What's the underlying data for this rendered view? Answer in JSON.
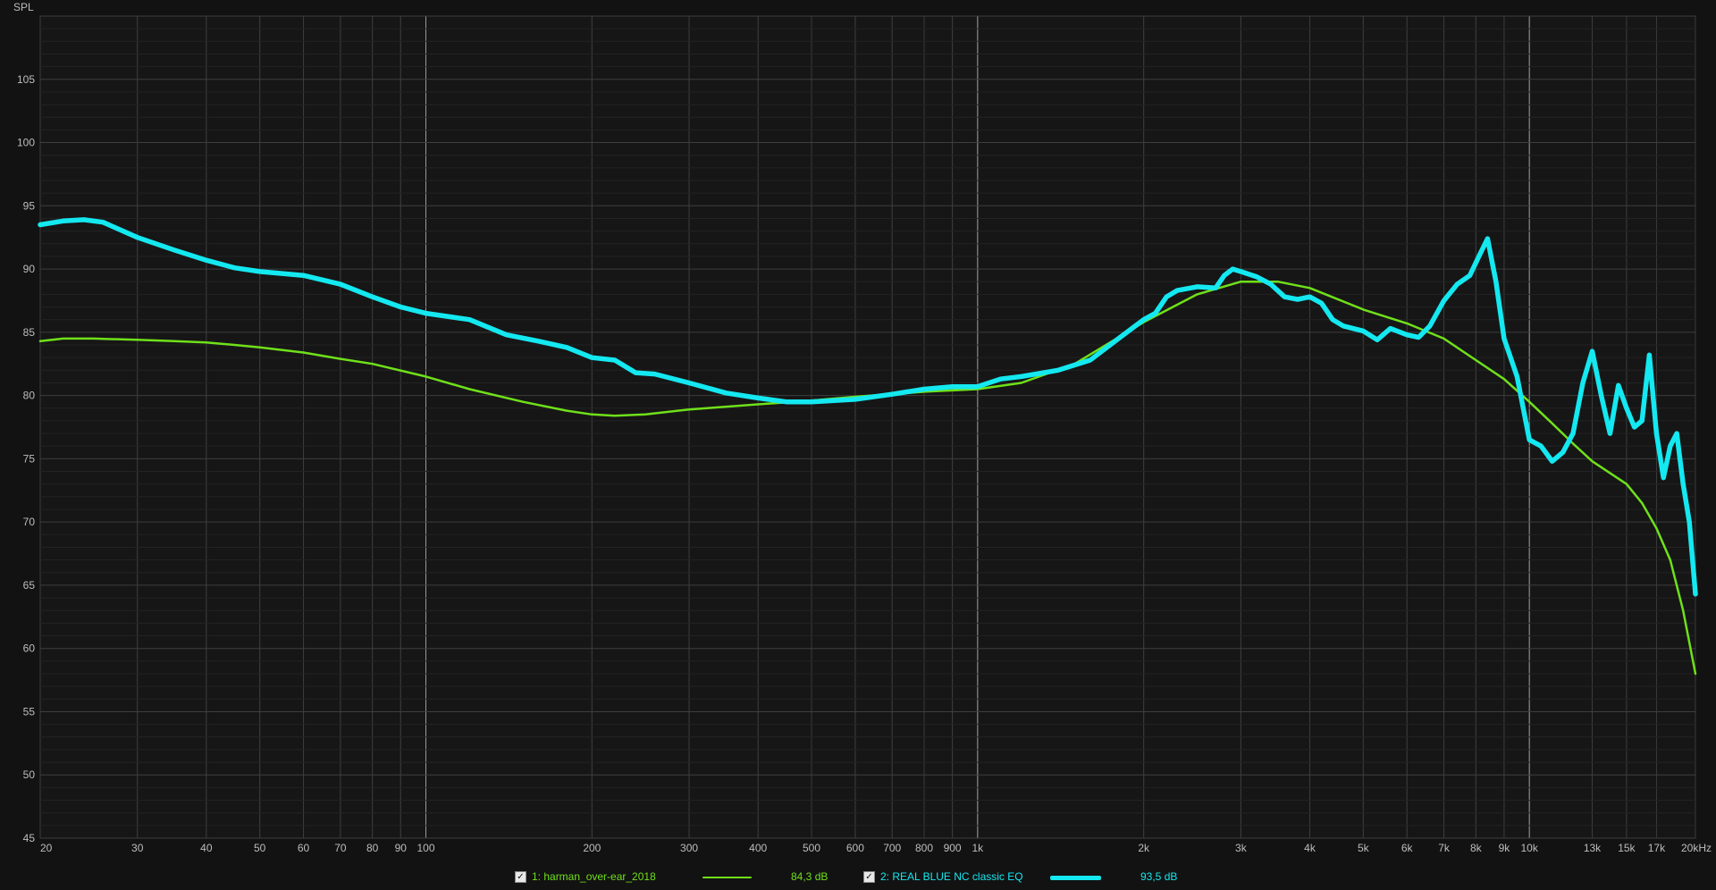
{
  "chart_data": {
    "type": "line",
    "ylabel": "SPL",
    "xscale": "log",
    "xlim": [
      20,
      20000
    ],
    "ylim": [
      45,
      110
    ],
    "yticks": [
      45,
      50,
      55,
      60,
      65,
      70,
      75,
      80,
      85,
      90,
      95,
      100,
      105
    ],
    "xticks": [
      {
        "v": 20,
        "l": "20"
      },
      {
        "v": 30,
        "l": "30"
      },
      {
        "v": 40,
        "l": "40"
      },
      {
        "v": 50,
        "l": "50"
      },
      {
        "v": 60,
        "l": "60"
      },
      {
        "v": 70,
        "l": "70"
      },
      {
        "v": 80,
        "l": "80"
      },
      {
        "v": 90,
        "l": "90"
      },
      {
        "v": 100,
        "l": "100"
      },
      {
        "v": 200,
        "l": "200"
      },
      {
        "v": 300,
        "l": "300"
      },
      {
        "v": 400,
        "l": "400"
      },
      {
        "v": 500,
        "l": "500"
      },
      {
        "v": 600,
        "l": "600"
      },
      {
        "v": 700,
        "l": "700"
      },
      {
        "v": 800,
        "l": "800"
      },
      {
        "v": 900,
        "l": "900"
      },
      {
        "v": 1000,
        "l": "1k"
      },
      {
        "v": 2000,
        "l": "2k"
      },
      {
        "v": 3000,
        "l": "3k"
      },
      {
        "v": 4000,
        "l": "4k"
      },
      {
        "v": 5000,
        "l": "5k"
      },
      {
        "v": 6000,
        "l": "6k"
      },
      {
        "v": 7000,
        "l": "7k"
      },
      {
        "v": 8000,
        "l": "8k"
      },
      {
        "v": 9000,
        "l": "9k"
      },
      {
        "v": 10000,
        "l": "10k"
      },
      {
        "v": 13000,
        "l": "13k"
      },
      {
        "v": 15000,
        "l": "15k"
      },
      {
        "v": 17000,
        "l": "17k"
      },
      {
        "v": 20000,
        "l": "20kHz"
      }
    ],
    "major_x_lines": [
      100,
      1000,
      10000
    ],
    "grid": true,
    "series": [
      {
        "name": "1: harman_over-ear_2018",
        "color": "#6fe01a",
        "x": [
          20,
          22,
          25,
          30,
          35,
          40,
          45,
          50,
          60,
          70,
          80,
          100,
          120,
          150,
          180,
          200,
          220,
          250,
          300,
          400,
          500,
          600,
          800,
          1000,
          1200,
          1500,
          2000,
          2500,
          3000,
          3500,
          4000,
          5000,
          6000,
          7000,
          8000,
          9000,
          10000,
          11000,
          12000,
          13000,
          15000,
          16000,
          17000,
          18000,
          19000,
          20000
        ],
        "values": [
          84.3,
          84.5,
          84.5,
          84.4,
          84.3,
          84.2,
          84.0,
          83.8,
          83.4,
          82.9,
          82.5,
          81.5,
          80.5,
          79.5,
          78.8,
          78.5,
          78.4,
          78.5,
          78.9,
          79.3,
          79.6,
          79.9,
          80.3,
          80.5,
          81.0,
          82.5,
          85.8,
          88.0,
          89.0,
          89.0,
          88.5,
          86.8,
          85.7,
          84.5,
          82.8,
          81.3,
          79.5,
          77.8,
          76.2,
          74.8,
          73.0,
          71.5,
          69.5,
          67.0,
          63.0,
          58.0
        ]
      },
      {
        "name": "2: REAL BLUE NC classic EQ",
        "color": "#14e8f0",
        "x": [
          20,
          22,
          24,
          26,
          30,
          35,
          40,
          45,
          50,
          60,
          70,
          80,
          90,
          100,
          120,
          140,
          160,
          180,
          200,
          220,
          240,
          260,
          300,
          350,
          400,
          450,
          500,
          600,
          700,
          800,
          900,
          1000,
          1100,
          1200,
          1400,
          1600,
          1800,
          2000,
          2100,
          2200,
          2300,
          2500,
          2700,
          2800,
          2900,
          3000,
          3200,
          3400,
          3600,
          3800,
          4000,
          4200,
          4400,
          4600,
          5000,
          5300,
          5600,
          6000,
          6300,
          6600,
          7000,
          7400,
          7800,
          8100,
          8400,
          8700,
          9000,
          9500,
          10000,
          10500,
          11000,
          11500,
          12000,
          12500,
          13000,
          13500,
          14000,
          14500,
          15000,
          15500,
          16000,
          16500,
          17000,
          17500,
          18000,
          18500,
          19000,
          19500,
          20000
        ],
        "values": [
          93.5,
          93.8,
          93.9,
          93.7,
          92.5,
          91.5,
          90.7,
          90.1,
          89.8,
          89.5,
          88.8,
          87.8,
          87.0,
          86.5,
          86.0,
          84.8,
          84.3,
          83.8,
          83.0,
          82.8,
          81.8,
          81.7,
          81.0,
          80.2,
          79.8,
          79.5,
          79.5,
          79.7,
          80.1,
          80.5,
          80.7,
          80.7,
          81.3,
          81.5,
          82.0,
          82.8,
          84.5,
          86.0,
          86.5,
          87.8,
          88.3,
          88.6,
          88.5,
          89.5,
          90.0,
          89.8,
          89.4,
          88.8,
          87.8,
          87.6,
          87.8,
          87.3,
          86.0,
          85.5,
          85.1,
          84.4,
          85.3,
          84.8,
          84.6,
          85.5,
          87.5,
          88.8,
          89.5,
          91.0,
          92.4,
          89.0,
          84.5,
          81.5,
          76.5,
          76.0,
          74.8,
          75.5,
          77.0,
          81.0,
          83.5,
          80.0,
          77.0,
          80.8,
          79.0,
          77.5,
          78.0,
          83.2,
          77.0,
          73.5,
          76.0,
          77.0,
          73.0,
          70.0,
          64.3
        ]
      }
    ]
  },
  "legend": {
    "items": [
      {
        "checkbox": "✓",
        "label": "1: harman_over-ear_2018",
        "level": "84,3 dB",
        "color": "#6fe01a"
      },
      {
        "checkbox": "✓",
        "label": "2: REAL BLUE NC classic EQ",
        "level": "93,5 dB",
        "color": "#14e8f0"
      }
    ]
  }
}
